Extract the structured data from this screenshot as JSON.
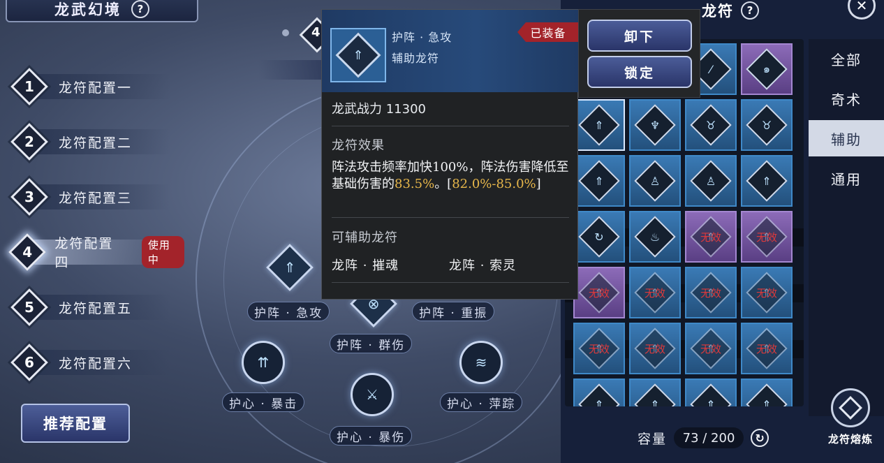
{
  "header": {
    "title": "龙武幻境",
    "help": "?"
  },
  "configs": [
    {
      "num": "1",
      "label": "龙符配置一"
    },
    {
      "num": "2",
      "label": "龙符配置二"
    },
    {
      "num": "3",
      "label": "龙符配置三"
    },
    {
      "num": "4",
      "label": "龙符配置四",
      "badge": "使用中",
      "active": true
    },
    {
      "num": "5",
      "label": "龙符配置五"
    },
    {
      "num": "6",
      "label": "龙符配置六"
    }
  ],
  "recommend_label": "推荐配置",
  "wheel": {
    "peek_num": "4",
    "slots": [
      {
        "label": "护阵 · 急攻",
        "glyph": "⇑"
      },
      {
        "label": "护阵 · 群伤",
        "glyph": "⊗"
      },
      {
        "label": "护阵 · 重振",
        "glyph": "↺"
      },
      {
        "label": "护心 · 暴击",
        "glyph": "⇈"
      },
      {
        "label": "护心 · 暴伤",
        "glyph": "⚔"
      },
      {
        "label": "护心 · 萍踪",
        "glyph": "≋"
      }
    ]
  },
  "tooltip": {
    "name": "护阵 · 急攻",
    "type": "辅助龙符",
    "equipped": "已装备",
    "icon_glyph": "⇑",
    "power_label": "龙武战力",
    "power_value": "11300",
    "effect_title": "龙符效果",
    "effect_text_1": "阵法攻击频率加快100%，阵法伤害降低至基础伤害的",
    "effect_value": "83.5%",
    "effect_text_2": "。[",
    "effect_range": "82.0%-85.0%",
    "effect_text_3": "]",
    "assist_title": "可辅助龙符",
    "assist_items": [
      "龙阵 · 摧魂",
      "龙阵 · 索灵"
    ]
  },
  "actions": {
    "unequip": "卸下",
    "lock": "锁定"
  },
  "panel": {
    "title": "龙符",
    "help": "?",
    "close": "✕",
    "tabs": [
      "全部",
      "奇术",
      "辅助",
      "通用"
    ],
    "active_tab": "辅助",
    "invalid_label": "无效",
    "capacity_label": "容量",
    "capacity_value": "73 / 200",
    "smelt_label": "龙符熔炼",
    "grid": [
      [
        {
          "c": "blue",
          "g": "⚡"
        },
        {
          "c": "blue",
          "g": "⚡"
        },
        {
          "c": "blue",
          "g": "⁄"
        },
        {
          "c": "purple",
          "g": "๑"
        }
      ],
      [
        {
          "c": "blue",
          "g": "⇑",
          "sel": true
        },
        {
          "c": "blue",
          "g": "♆"
        },
        {
          "c": "blue",
          "g": "♉"
        },
        {
          "c": "blue",
          "g": "♉"
        }
      ],
      [
        {
          "c": "blue",
          "g": "⇑"
        },
        {
          "c": "blue",
          "g": "♙"
        },
        {
          "c": "blue",
          "g": "♙"
        },
        {
          "c": "blue",
          "g": "⇑"
        }
      ],
      [
        {
          "c": "blue",
          "g": "↻"
        },
        {
          "c": "blue",
          "g": "♨"
        },
        {
          "c": "purple",
          "g": "⇑",
          "inv": true
        },
        {
          "c": "purple",
          "g": "⇑",
          "inv": true
        }
      ],
      [
        {
          "c": "purple",
          "g": "⇑",
          "inv": true
        },
        {
          "c": "blue",
          "g": "⇑",
          "inv": true
        },
        {
          "c": "blue",
          "g": "⇑",
          "inv": true
        },
        {
          "c": "blue",
          "g": "⇑",
          "inv": true
        }
      ],
      [
        {
          "c": "blue",
          "g": "⇑",
          "inv": true
        },
        {
          "c": "blue",
          "g": "⇑",
          "inv": true
        },
        {
          "c": "blue",
          "g": "⇑",
          "inv": true
        },
        {
          "c": "blue",
          "g": "⇑",
          "inv": true
        }
      ],
      [
        {
          "c": "blue",
          "g": "⇑"
        },
        {
          "c": "blue",
          "g": "⇑"
        },
        {
          "c": "blue",
          "g": "⇑"
        },
        {
          "c": "blue",
          "g": "⇑"
        }
      ]
    ]
  },
  "colors": {
    "accent_red": "#a3232a",
    "gold": "#e6b64a",
    "invalid_red": "#e0393a"
  }
}
